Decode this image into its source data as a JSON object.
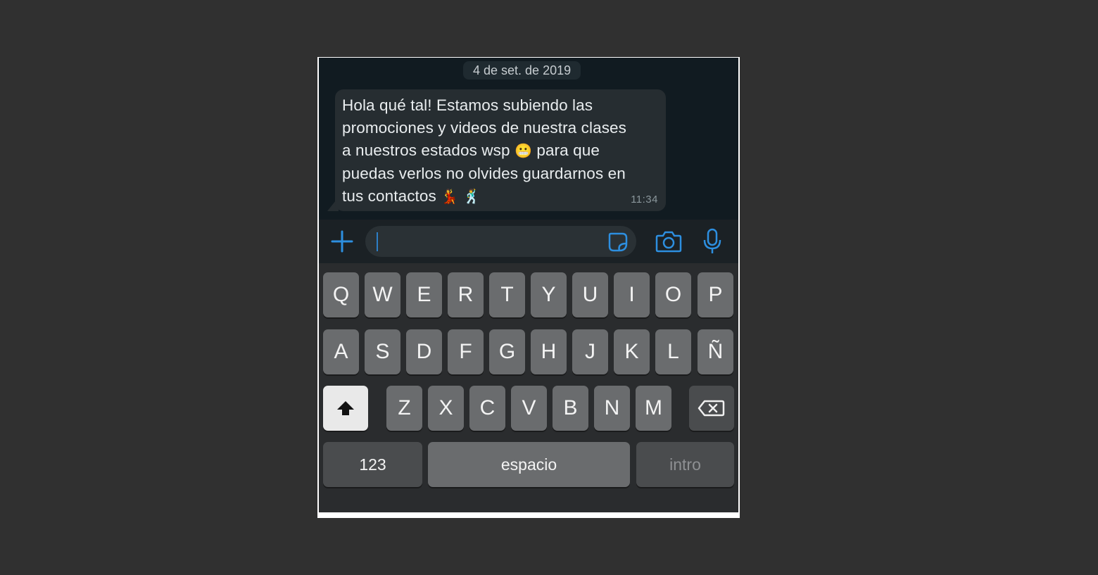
{
  "chat": {
    "date": "4 de set. de 2019",
    "message": {
      "text_lines": [
        "Hola qué tal! Estamos subiendo las",
        "promociones y videos de nuestra clases",
        "a nuestros estados wsp",
        "para que",
        "puedas verlos no olvides guardarnos en",
        "tus contactos"
      ],
      "time": "11:34"
    }
  },
  "input_bar": {
    "plus_icon": "plus-icon",
    "sticker_icon": "sticker-icon",
    "camera_icon": "camera-icon",
    "mic_icon": "microphone-icon"
  },
  "keyboard": {
    "row1": [
      "Q",
      "W",
      "E",
      "R",
      "T",
      "Y",
      "U",
      "I",
      "O",
      "P"
    ],
    "row2": [
      "A",
      "S",
      "D",
      "F",
      "G",
      "H",
      "J",
      "K",
      "L",
      "Ñ"
    ],
    "row3": [
      "Z",
      "X",
      "C",
      "V",
      "B",
      "N",
      "M"
    ],
    "numbers_label": "123",
    "space_label": "espacio",
    "return_label": "intro"
  },
  "colors": {
    "accent": "#2d8fe0",
    "background": "#303030",
    "bubble": "#262d31"
  }
}
